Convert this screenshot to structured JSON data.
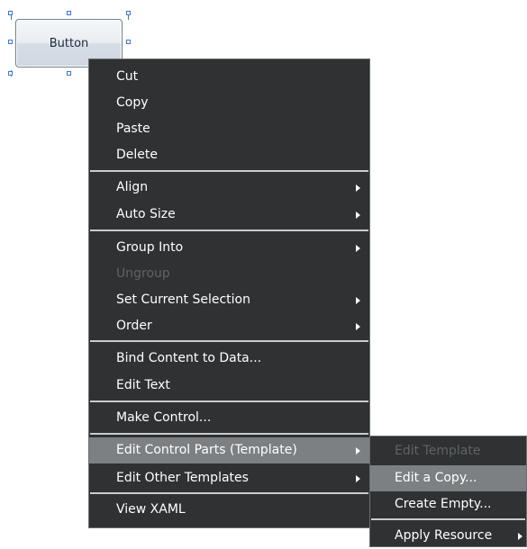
{
  "design_surface": {
    "button_label": "Button"
  },
  "context_menu": {
    "items": [
      {
        "label": "Cut"
      },
      {
        "label": "Copy"
      },
      {
        "label": "Paste"
      },
      {
        "label": "Delete"
      },
      {
        "label": "Align"
      },
      {
        "label": "Auto Size"
      },
      {
        "label": "Group Into"
      },
      {
        "label": "Ungroup"
      },
      {
        "label": "Set Current Selection"
      },
      {
        "label": "Order"
      },
      {
        "label": "Bind Content to Data..."
      },
      {
        "label": "Edit Text"
      },
      {
        "label": "Make Control..."
      },
      {
        "label": "Edit Control Parts (Template)"
      },
      {
        "label": "Edit Other Templates"
      },
      {
        "label": "View XAML"
      }
    ]
  },
  "submenu": {
    "items": [
      {
        "label": "Edit Template"
      },
      {
        "label": "Edit a Copy..."
      },
      {
        "label": "Create Empty..."
      },
      {
        "label": "Apply Resource"
      }
    ]
  },
  "colors": {
    "menu_background": "#2f3133",
    "menu_highlight": "#7d8083",
    "disabled_text": "#5f6366",
    "selection_handle": "#3a78d8"
  }
}
